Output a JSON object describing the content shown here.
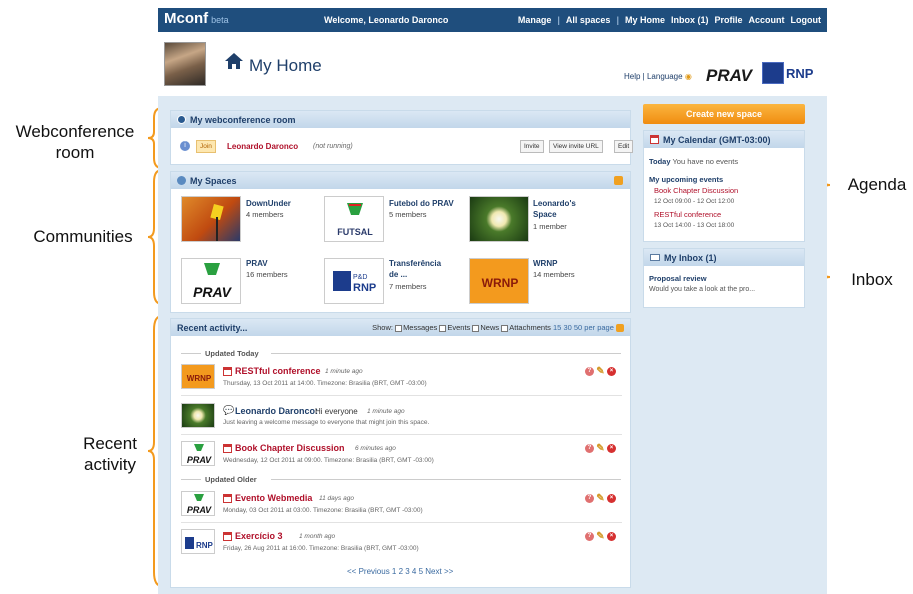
{
  "annotations": {
    "webconference": "Webconference room",
    "communities": "Communities",
    "recent_activity": "Recent activity",
    "agenda": "Agenda",
    "inbox": "Inbox"
  },
  "topbar": {
    "logo": "Mconf",
    "beta": "beta",
    "welcome": "Welcome, Leonardo Daronco",
    "nav": [
      "Manage",
      "All spaces",
      "My Home",
      "Inbox (1)",
      "Profile",
      "Account",
      "Logout"
    ]
  },
  "header": {
    "title": "My Home",
    "help": "Help",
    "language": "Language",
    "prav": "PRAV",
    "rnp": "RNP"
  },
  "webconf": {
    "title": "My webconference room",
    "join": "Join",
    "owner": "Leonardo Daronco",
    "status": "(not running)",
    "buttons": [
      "Invite",
      "View invite URL",
      "Edit"
    ]
  },
  "spaces": {
    "title": "My Spaces",
    "items": [
      {
        "name": "DownUnder",
        "members": "4 members"
      },
      {
        "name": "Futebol do PRAV",
        "members": "5 members"
      },
      {
        "name": "Leonardo's Space",
        "members": "1 member"
      },
      {
        "name": "PRAV",
        "members": "16 members"
      },
      {
        "name": "Transferência de ...",
        "members": "7 members"
      },
      {
        "name": "WRNP",
        "members": "14 members"
      }
    ]
  },
  "activity": {
    "title": "Recent activity...",
    "show": "Show:",
    "filters": [
      "Messages",
      "Events",
      "News",
      "Attachments"
    ],
    "per_page": "15 30 50 per page",
    "today": "Updated Today",
    "older": "Updated Older",
    "items": [
      {
        "title": "RESTful conference",
        "ago": "1 minute ago",
        "meta": "Thursday, 13 Oct 2011 at 14:00. Timezone: Brasilia (BRT, GMT -03:00)"
      },
      {
        "title": "Leonardo Daronco:",
        "msg": "Hi everyone",
        "ago": "1 minute ago",
        "meta": "Just leaving a welcome message to everyone that might join this space."
      },
      {
        "title": "Book Chapter Discussion",
        "ago": "6 minutes ago",
        "meta": "Wednesday, 12 Oct 2011 at 09:00. Timezone: Brasilia (BRT, GMT -03:00)"
      },
      {
        "title": "Evento Webmedia",
        "ago": "11 days ago",
        "meta": "Monday, 03 Oct 2011 at 03:00. Timezone: Brasilia (BRT, GMT -03:00)"
      },
      {
        "title": "Exercício 3",
        "ago": "1 month ago",
        "meta": "Friday, 26 Aug 2011 at 16:00. Timezone: Brasilia (BRT, GMT -03:00)"
      }
    ],
    "pagination": "<< Previous 1 2 3 4 5 Next >>"
  },
  "sidebar": {
    "create": "Create new space",
    "calendar_title": "My Calendar (GMT-03:00)",
    "today_label": "Today",
    "today_text": "You have no events",
    "upcoming": "My upcoming events",
    "events": [
      {
        "name": "Book Chapter Discussion",
        "when": "12 Oct 09:00 - 12 Oct 12:00"
      },
      {
        "name": "RESTful conference",
        "when": "13 Oct 14:00 - 13 Oct 18:00"
      }
    ],
    "inbox_title": "My Inbox (1)",
    "inbox_subject": "Proposal review",
    "inbox_preview": "Would you take a look at the pro..."
  }
}
